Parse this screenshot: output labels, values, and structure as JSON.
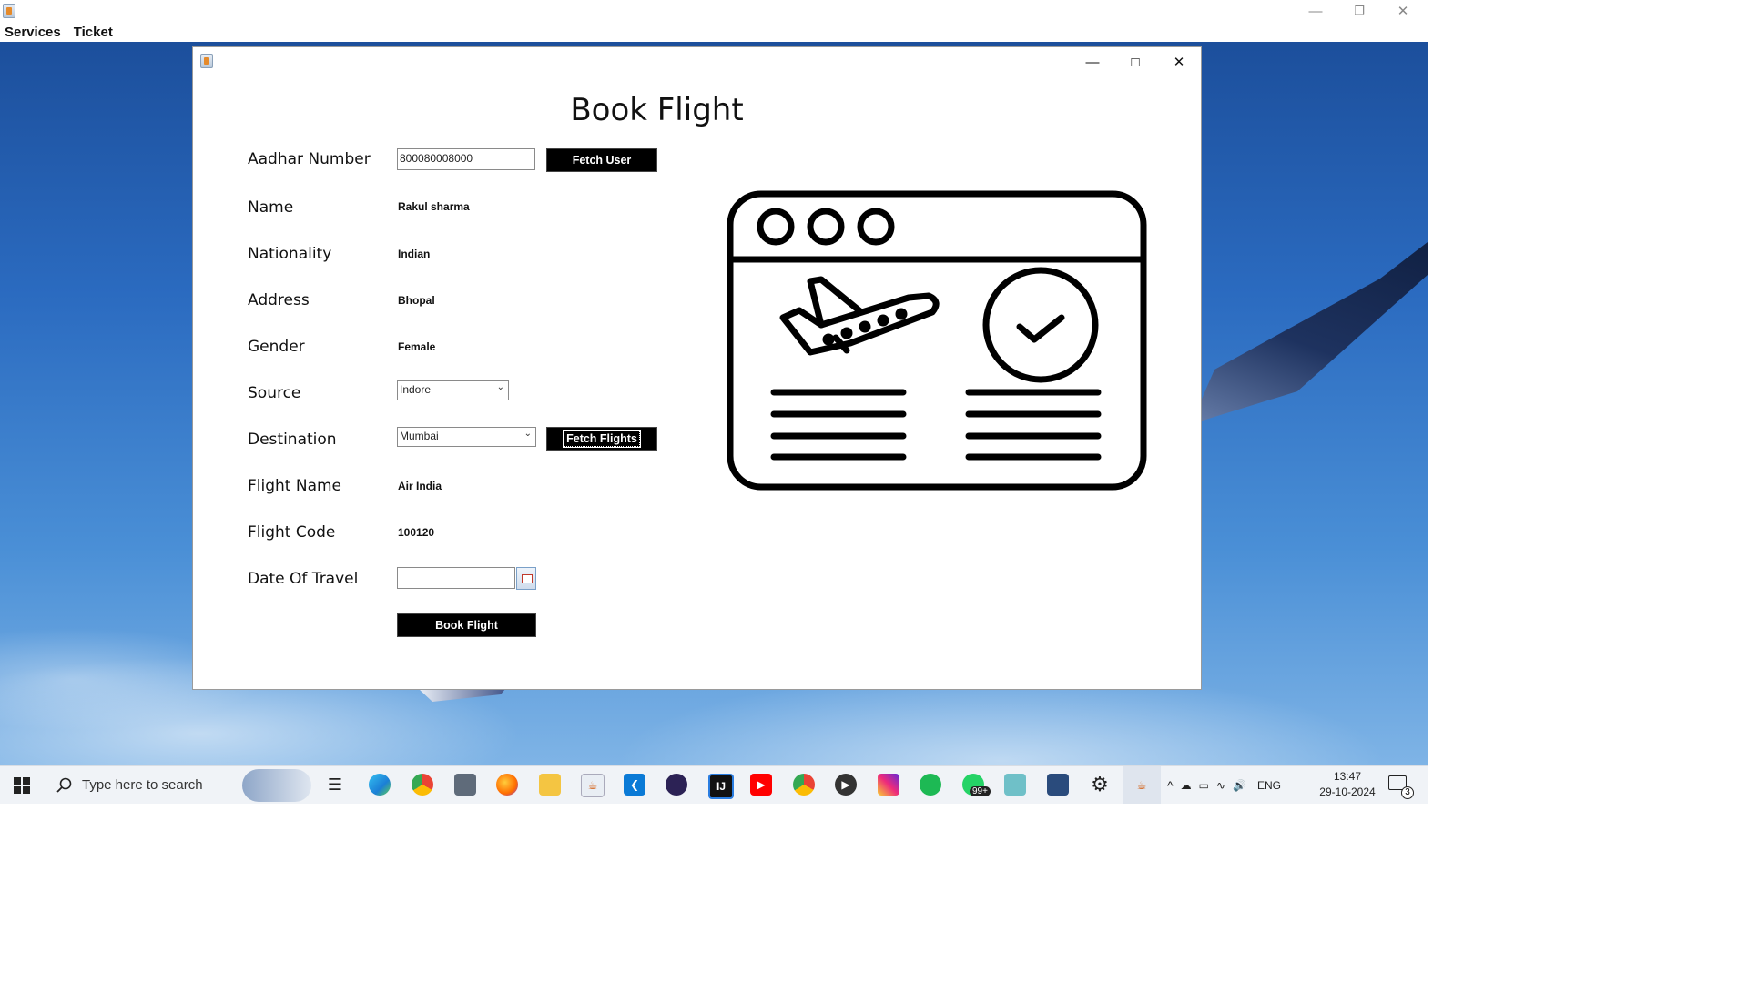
{
  "menubar": {
    "items": [
      "Services",
      "Ticket"
    ]
  },
  "dialog": {
    "title": "Book Flight",
    "fields": {
      "aadhar_label": "Aadhar Number",
      "aadhar_value": "800080008000",
      "fetch_user_label": "Fetch User",
      "name_label": "Name",
      "name_value": "Rakul sharma",
      "nationality_label": "Nationality",
      "nationality_value": "Indian",
      "address_label": "Address",
      "address_value": "Bhopal",
      "gender_label": "Gender",
      "gender_value": "Female",
      "source_label": "Source",
      "source_value": "Indore",
      "destination_label": "Destination",
      "destination_value": "Mumbai",
      "fetch_flights_label": "Fetch Flights",
      "flight_name_label": "Flight Name",
      "flight_name_value": "Air India",
      "flight_code_label": "Flight Code",
      "flight_code_value": "100120",
      "date_label": "Date Of Travel",
      "date_value": "",
      "book_button_label": "Book Flight"
    },
    "illustration": "flight-booking-browser-icon"
  },
  "taskbar": {
    "search_placeholder": "Type here to search",
    "language": "ENG",
    "time": "13:47",
    "date": "29-10-2024",
    "notification_count": "3",
    "whatsapp_badge": "99+"
  },
  "colors": {
    "button_bg": "#000000",
    "button_text": "#ffffff",
    "sky_blue": "#2b6bc0"
  }
}
